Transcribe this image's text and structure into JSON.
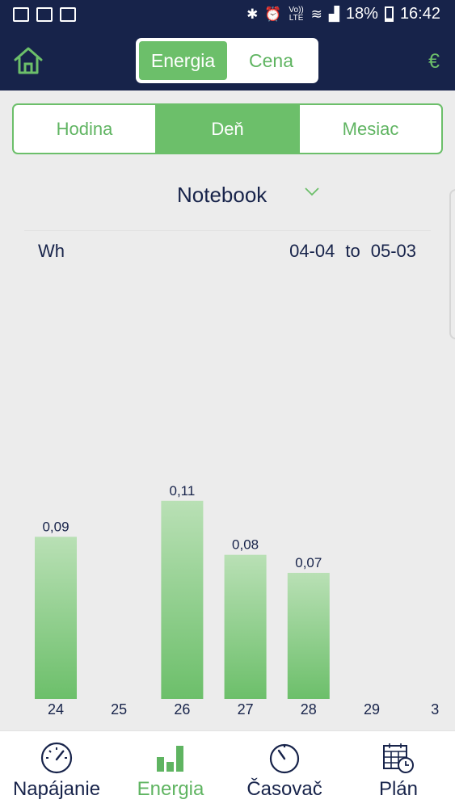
{
  "status_bar": {
    "battery_percent": "18%",
    "time": "16:42",
    "network_badge": "Vo)) LTE"
  },
  "header": {
    "mode_tabs": [
      {
        "label": "Energia",
        "active": true
      },
      {
        "label": "Cena",
        "active": false
      }
    ],
    "currency_symbol": "€",
    "home_icon": "home-icon"
  },
  "period_tabs": [
    {
      "label": "Hodina",
      "active": false
    },
    {
      "label": "Deň",
      "active": true
    },
    {
      "label": "Mesiac",
      "active": false
    }
  ],
  "device": {
    "name": "Notebook",
    "icon": "chevron-down-icon"
  },
  "summary": {
    "unit": "Wh",
    "range_start": "04-04",
    "range_sep": "to",
    "range_end": "05-03"
  },
  "colors": {
    "accent": "#6cbf6a",
    "header_bg": "#17234a",
    "bar_top": "#b9e0b5",
    "bar_bottom": "#6cbf6a"
  },
  "chart_data": {
    "type": "bar",
    "categories": [
      "24",
      "25",
      "26",
      "27",
      "28",
      "29",
      "3"
    ],
    "values": [
      0.09,
      0,
      0.11,
      0.08,
      0.07,
      0,
      null
    ],
    "value_labels": [
      "0,09",
      "",
      "0,11",
      "0,08",
      "0,07",
      "",
      ""
    ],
    "ylabel": "Wh",
    "ylim": [
      0,
      0.24
    ],
    "grid": false
  },
  "bottom_nav": [
    {
      "label": "Napájanie",
      "icon": "gauge-icon",
      "active": false
    },
    {
      "label": "Energia",
      "icon": "bar-chart-icon",
      "active": true
    },
    {
      "label": "Časovač",
      "icon": "timer-icon",
      "active": false
    },
    {
      "label": "Plán",
      "icon": "calendar-clock-icon",
      "active": false
    }
  ]
}
